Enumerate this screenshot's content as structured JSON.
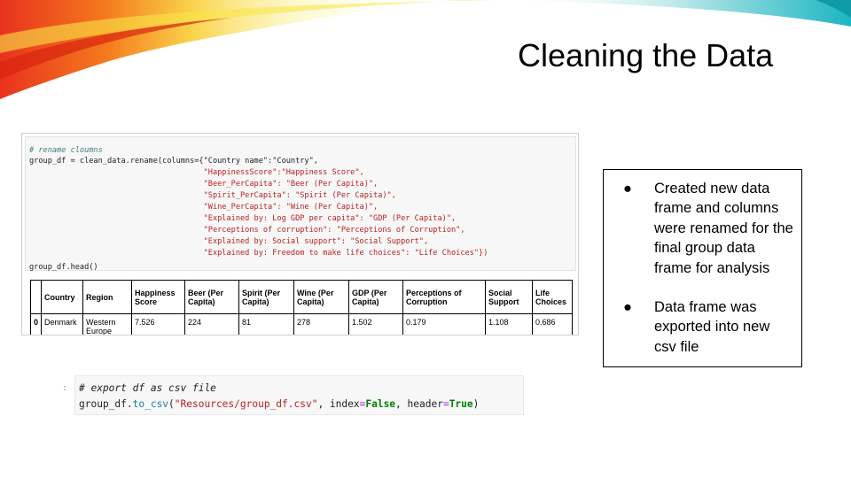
{
  "slide": {
    "title": "Cleaning the Data"
  },
  "code_cell_1": {
    "lines": [
      "# rename cloumns",
      "group_df = clean_data.rename(columns={\"Country name\":\"Country\",",
      "                                      \"HappinessScore\":\"Happiness Score\",",
      "                                      \"Beer_PerCapita\": \"Beer (Per Capita)\",",
      "                                      \"Spirit_PerCapita\": \"Spirit (Per Capita)\",",
      "                                      \"Wine_PerCapita\": \"Wine (Per Capita)\",",
      "                                      \"Explained by: Log GDP per capita\": \"GDP (Per Capita)\",",
      "                                      \"Perceptions of corruption\": \"Perceptions of Corruption\",",
      "                                      \"Explained by: Social support\": \"Social Support\",",
      "                                      \"Explained by: Freedom to make life choices\": \"Life Choices\"})",
      "group_df.head()"
    ]
  },
  "dataframe": {
    "columns": [
      "",
      "Country",
      "Region",
      "Happiness Score",
      "Beer (Per Capita)",
      "Spirit (Per Capita)",
      "Wine (Per Capita)",
      "GDP (Per Capita)",
      "Perceptions of Corruption",
      "Social Support",
      "Life Choices"
    ],
    "rows": [
      [
        "0",
        "Denmark",
        "Western Europe",
        "7.526",
        "224",
        "81",
        "278",
        "1.502",
        "0.179",
        "1.108",
        "0.686"
      ]
    ]
  },
  "bullets": [
    "Created new data frame and columns were renamed for the final group data frame for analysis",
    "Data frame was exported into new csv file"
  ],
  "bullet_marker": "●",
  "code_cell_2": {
    "prompt": ":",
    "comment": "# export df as csv file",
    "obj": "group_df.",
    "method": "to_csv",
    "open": "(",
    "path": "\"Resources/group_df.csv\"",
    "sep1": ", index",
    "eq": "=",
    "val1": "False",
    "sep2": ", header",
    "val2": "True",
    "close": ")"
  },
  "colors": {
    "swoosh_red": "#e8321e",
    "swoosh_orange": "#f6a21b",
    "swoosh_yellow": "#f9e64a",
    "swoosh_teal": "#27c0c9"
  }
}
